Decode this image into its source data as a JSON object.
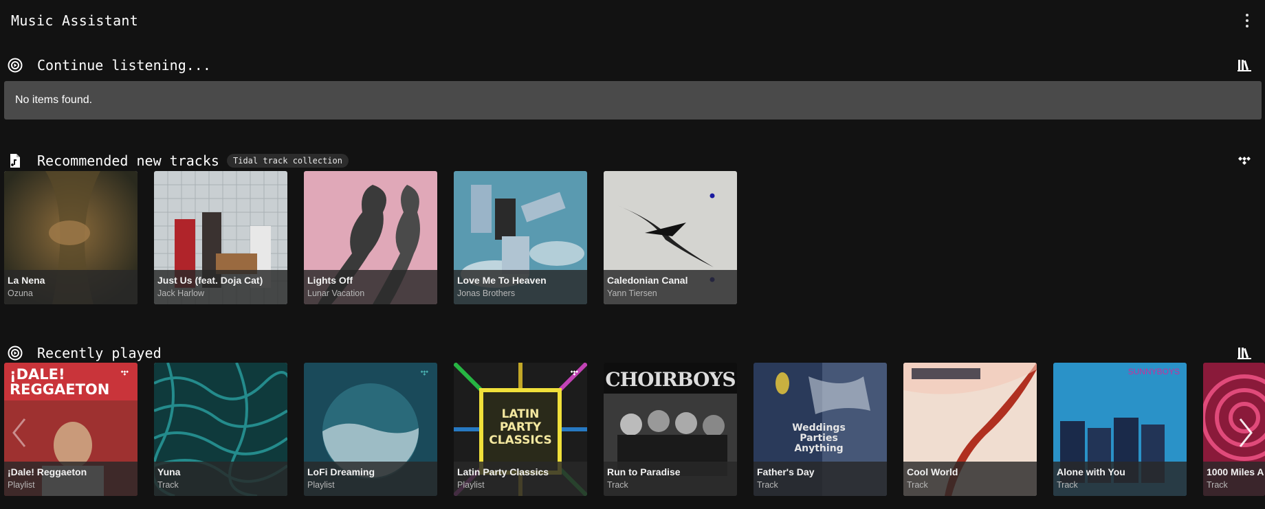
{
  "app": {
    "title": "Music Assistant"
  },
  "continue": {
    "title": "Continue listening...",
    "empty_text": "No items found."
  },
  "recommended": {
    "title": "Recommended new tracks",
    "badge": "Tidal track collection",
    "items": [
      {
        "title": "La Nena",
        "subtitle": "Ozuna"
      },
      {
        "title": "Just Us (feat. Doja Cat)",
        "subtitle": "Jack Harlow"
      },
      {
        "title": "Lights Off",
        "subtitle": "Lunar Vacation"
      },
      {
        "title": "Love Me To Heaven",
        "subtitle": "Jonas Brothers"
      },
      {
        "title": "Caledonian Canal",
        "subtitle": "Yann Tiersen"
      }
    ]
  },
  "recent": {
    "title": "Recently played",
    "items": [
      {
        "title": "¡Dale! Reggaeton",
        "subtitle": "Playlist",
        "art_text": "¡DALE! REGGAETON"
      },
      {
        "title": "Yuna",
        "subtitle": "Track"
      },
      {
        "title": "LoFi Dreaming",
        "subtitle": "Playlist"
      },
      {
        "title": "Latin Party Classics",
        "subtitle": "Playlist",
        "art_text": "LATIN PARTY CLASSICS"
      },
      {
        "title": "Run to Paradise",
        "subtitle": "Track",
        "art_text": "CHOIRBOYS"
      },
      {
        "title": "Father's Day",
        "subtitle": "Track",
        "art_text": "Weddings Parties Anything"
      },
      {
        "title": "Cool World",
        "subtitle": "Track"
      },
      {
        "title": "Alone with You",
        "subtitle": "Track",
        "art_text": "SUNNYBOYS"
      },
      {
        "title": "1000 Miles A",
        "subtitle": "Track"
      }
    ]
  },
  "icons": {
    "menu": "kebab-menu-icon",
    "continue": "record-play-icon",
    "recommended": "music-file-icon",
    "recent": "record-play-icon",
    "library": "library-icon",
    "tidal": "tidal-icon",
    "prev": "chevron-left-icon",
    "next": "chevron-right-icon"
  }
}
